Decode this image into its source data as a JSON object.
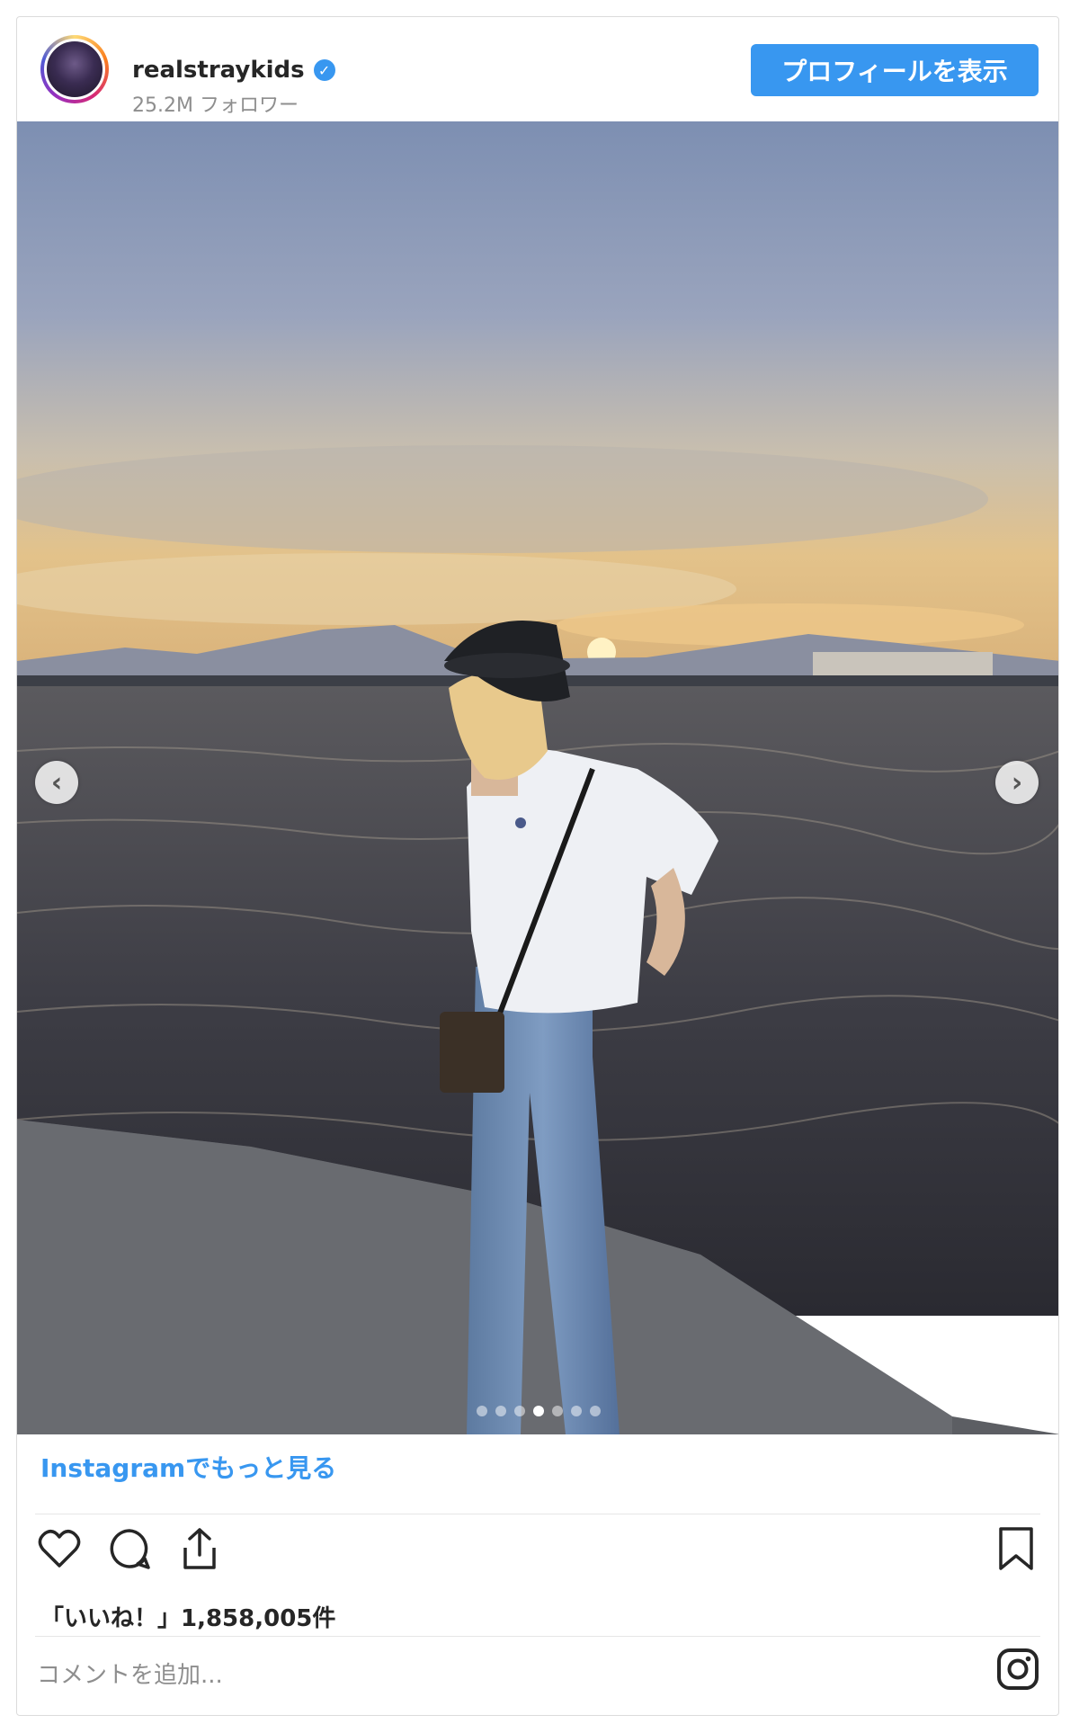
{
  "post": {
    "username": "realstraykids",
    "followers": "25.2M フォロワー",
    "profile_button": "プロフィールを表示",
    "more_on_instagram": "Instagramでもっと見る",
    "likes_text": "「いいね！」1,858,005件",
    "comment_placeholder": "コメントを追加...",
    "carousel": {
      "total": 7,
      "active_index": 3
    }
  },
  "icons": {
    "verified": "verified-badge-icon",
    "prev": "chevron-left-icon",
    "next": "chevron-right-icon",
    "like": "heart-icon",
    "comment": "comment-bubble-icon",
    "share": "share-icon",
    "save": "bookmark-icon",
    "brand": "instagram-logo-icon"
  },
  "colors": {
    "accent": "#3897f0",
    "text": "#262626",
    "secondary": "#8e8e8e"
  }
}
